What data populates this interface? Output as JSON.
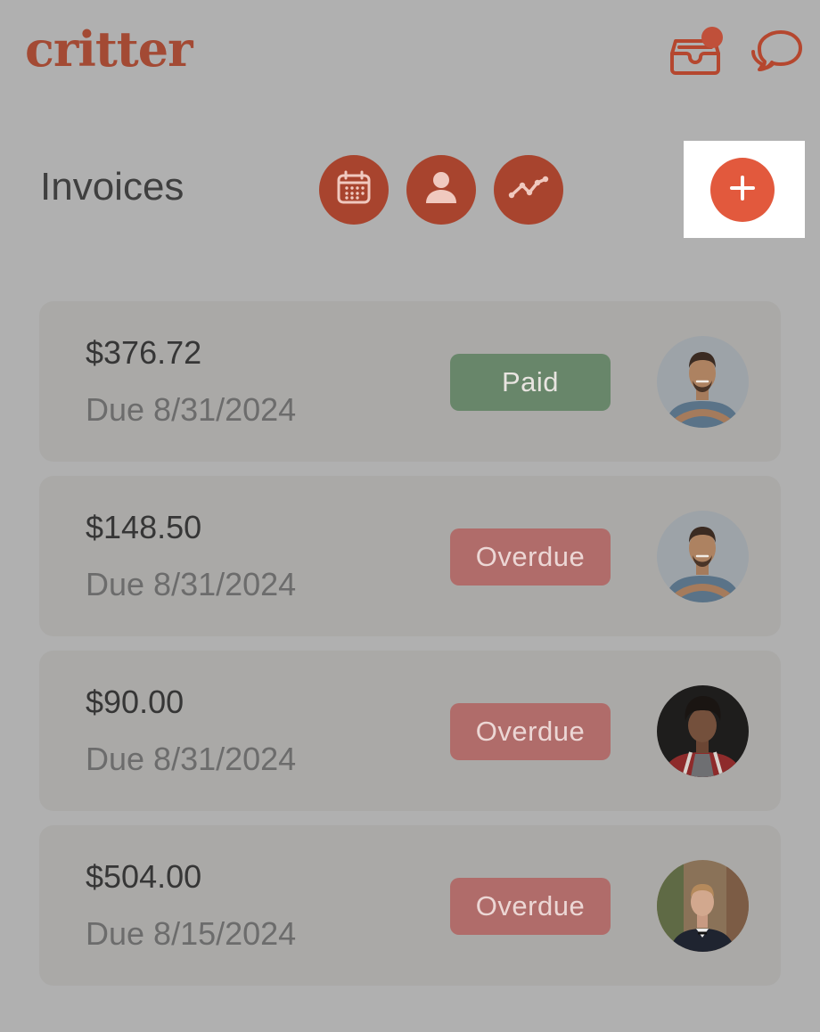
{
  "header": {
    "logo": "critter",
    "inbox_icon": "inbox-tray-icon",
    "chat_icon": "chat-bubbles-icon",
    "notification_color": "#c0503a"
  },
  "toolbar": {
    "title": "Invoices",
    "buttons": [
      {
        "icon": "calendar-icon"
      },
      {
        "icon": "user-icon"
      },
      {
        "icon": "trend-chart-icon"
      }
    ],
    "add_icon": "plus-icon",
    "accent": "#a8442e",
    "add_color": "#e2593d"
  },
  "invoices": [
    {
      "amount": "$376.72",
      "due": "Due 8/31/2024",
      "status": "Paid",
      "avatar": "avatar-man-blue-shirt"
    },
    {
      "amount": "$148.50",
      "due": "Due 8/31/2024",
      "status": "Overdue",
      "avatar": "avatar-man-blue-shirt"
    },
    {
      "amount": "$90.00",
      "due": "Due 8/31/2024",
      "status": "Overdue",
      "avatar": "avatar-young-man-red-jacket"
    },
    {
      "amount": "$504.00",
      "due": "Due 8/15/2024",
      "status": "Overdue",
      "avatar": "avatar-man-tuxedo"
    }
  ],
  "status_colors": {
    "paid": "#68866a",
    "overdue": "#b06c6a"
  }
}
